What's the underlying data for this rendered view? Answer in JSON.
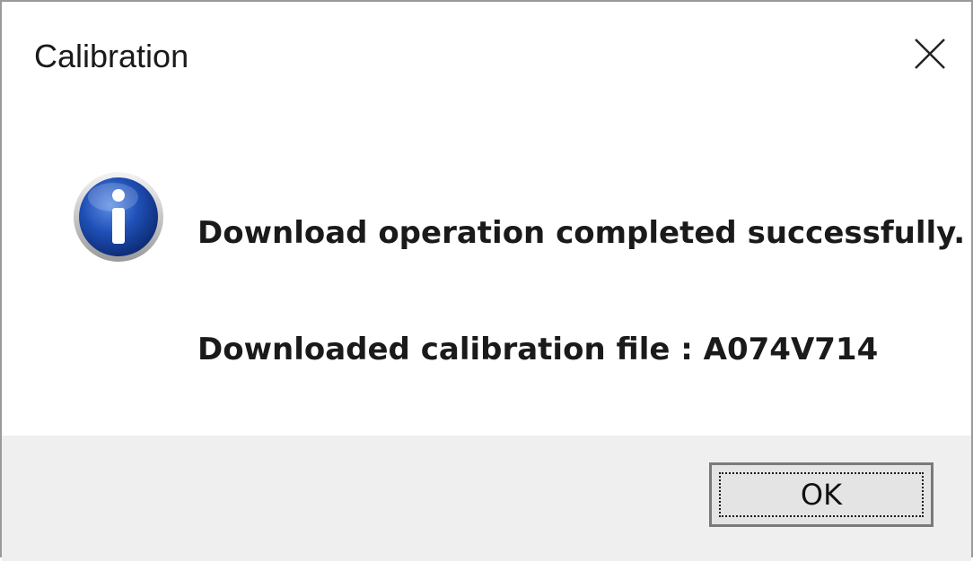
{
  "window": {
    "title": "Calibration",
    "close_icon": "close-icon"
  },
  "message": {
    "icon": "info-icon",
    "line1": "Download operation completed successfully.",
    "line2": "Downloaded calibration file : A074V714"
  },
  "buttons": {
    "ok_label": "OK"
  },
  "colors": {
    "footer_bg": "#efefef",
    "icon_blue": "#1f4fb5"
  }
}
